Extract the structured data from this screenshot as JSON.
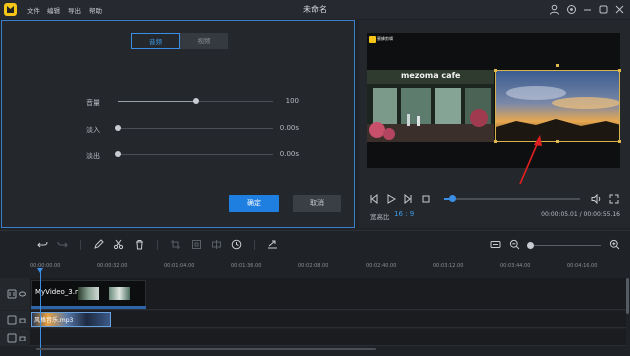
{
  "titlebar": {
    "title": "未命名",
    "menu": [
      "文件",
      "编辑",
      "导出",
      "帮助"
    ]
  },
  "audio_panel": {
    "tabs": [
      {
        "label": "音频",
        "active": true
      },
      {
        "label": "视频",
        "active": false
      }
    ],
    "controls": [
      {
        "label": "音量",
        "value": "100",
        "level": 0.5
      },
      {
        "label": "淡入",
        "value": "0.00s",
        "level": 0
      },
      {
        "label": "淡出",
        "value": "0.00s",
        "level": 0
      }
    ],
    "ok_label": "确定",
    "cancel_label": "取消"
  },
  "preview": {
    "watermark_text": "蜜蜂剪辑",
    "cafe_sign": "mezoma cafe",
    "aspect_label": "宽高比",
    "aspect_value": "16 : 9",
    "time_current": "00:00:05.01",
    "time_total": "00:00:55.16",
    "time_separator": " / ",
    "progress": 0.06
  },
  "timeline": {
    "ruler_ticks": [
      "00:00:00.00",
      "00:00:32.00",
      "00:01:04.00",
      "00:01:36.00",
      "00:02:08.00",
      "00:02:40.00",
      "00:03:12.00",
      "00:03:44.00",
      "00:04:16.00"
    ],
    "video_clip_name": "MyVideo_3.mp4",
    "bg_clip_name": "风格音乐.mp3"
  },
  "colors": {
    "accent": "#3a8ee6",
    "ok_button": "#1f7fe0",
    "logo": "#f5c518",
    "arrow": "#e02020"
  }
}
